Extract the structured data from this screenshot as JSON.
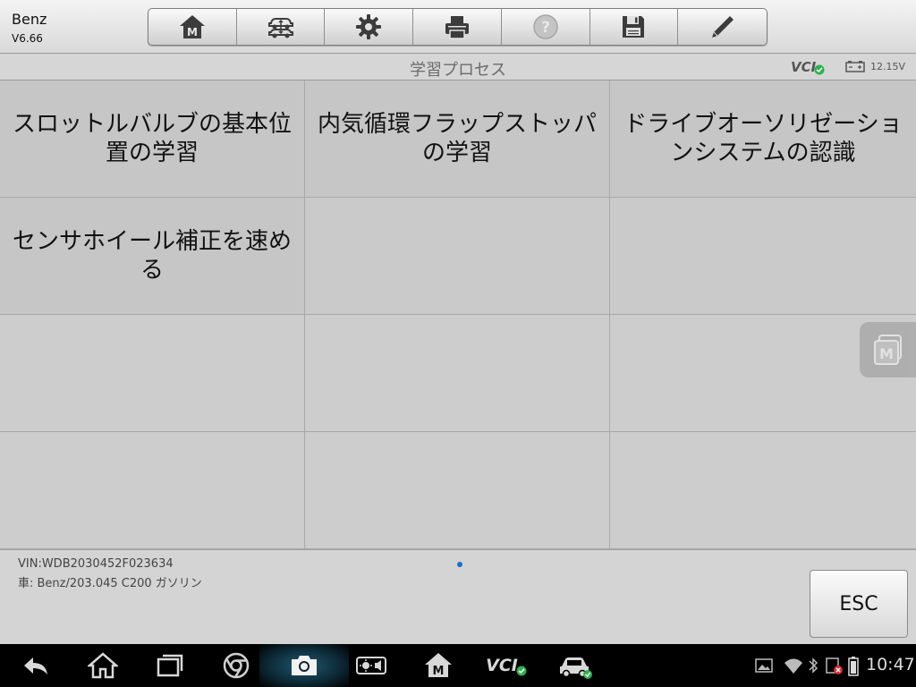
{
  "app": {
    "title": "Benz",
    "version": "V6.66"
  },
  "toolbar": {
    "buttons": [
      {
        "name": "home",
        "icon": "home-m-icon"
      },
      {
        "name": "vehicle-swap",
        "icon": "car-swap-icon"
      },
      {
        "name": "settings",
        "icon": "gear-icon"
      },
      {
        "name": "print",
        "icon": "printer-icon"
      },
      {
        "name": "help",
        "icon": "help-icon"
      },
      {
        "name": "save",
        "icon": "floppy-icon"
      },
      {
        "name": "edit",
        "icon": "pencil-icon"
      }
    ]
  },
  "header": {
    "page_title": "学習プロセス",
    "vci_label": "VCI",
    "voltage": "12.15V"
  },
  "grid": {
    "items": [
      "スロットルバルブの基本位置の学習",
      "内気循環フラップストッパの学習",
      "ドライブオーソリゼーションシステムの認識",
      "センサホイール補正を速める"
    ]
  },
  "footer": {
    "vin": "VIN:WDB2030452F023634",
    "vehicle": "車: Benz/203.045 C200 ガソリン",
    "esc_label": "ESC"
  },
  "navbar": {
    "vci_label": "VCI",
    "time": "10:47"
  },
  "colors": {
    "accent": "#1a6fc7",
    "ok_green": "#2bb24c",
    "error_red": "#d9262e"
  }
}
